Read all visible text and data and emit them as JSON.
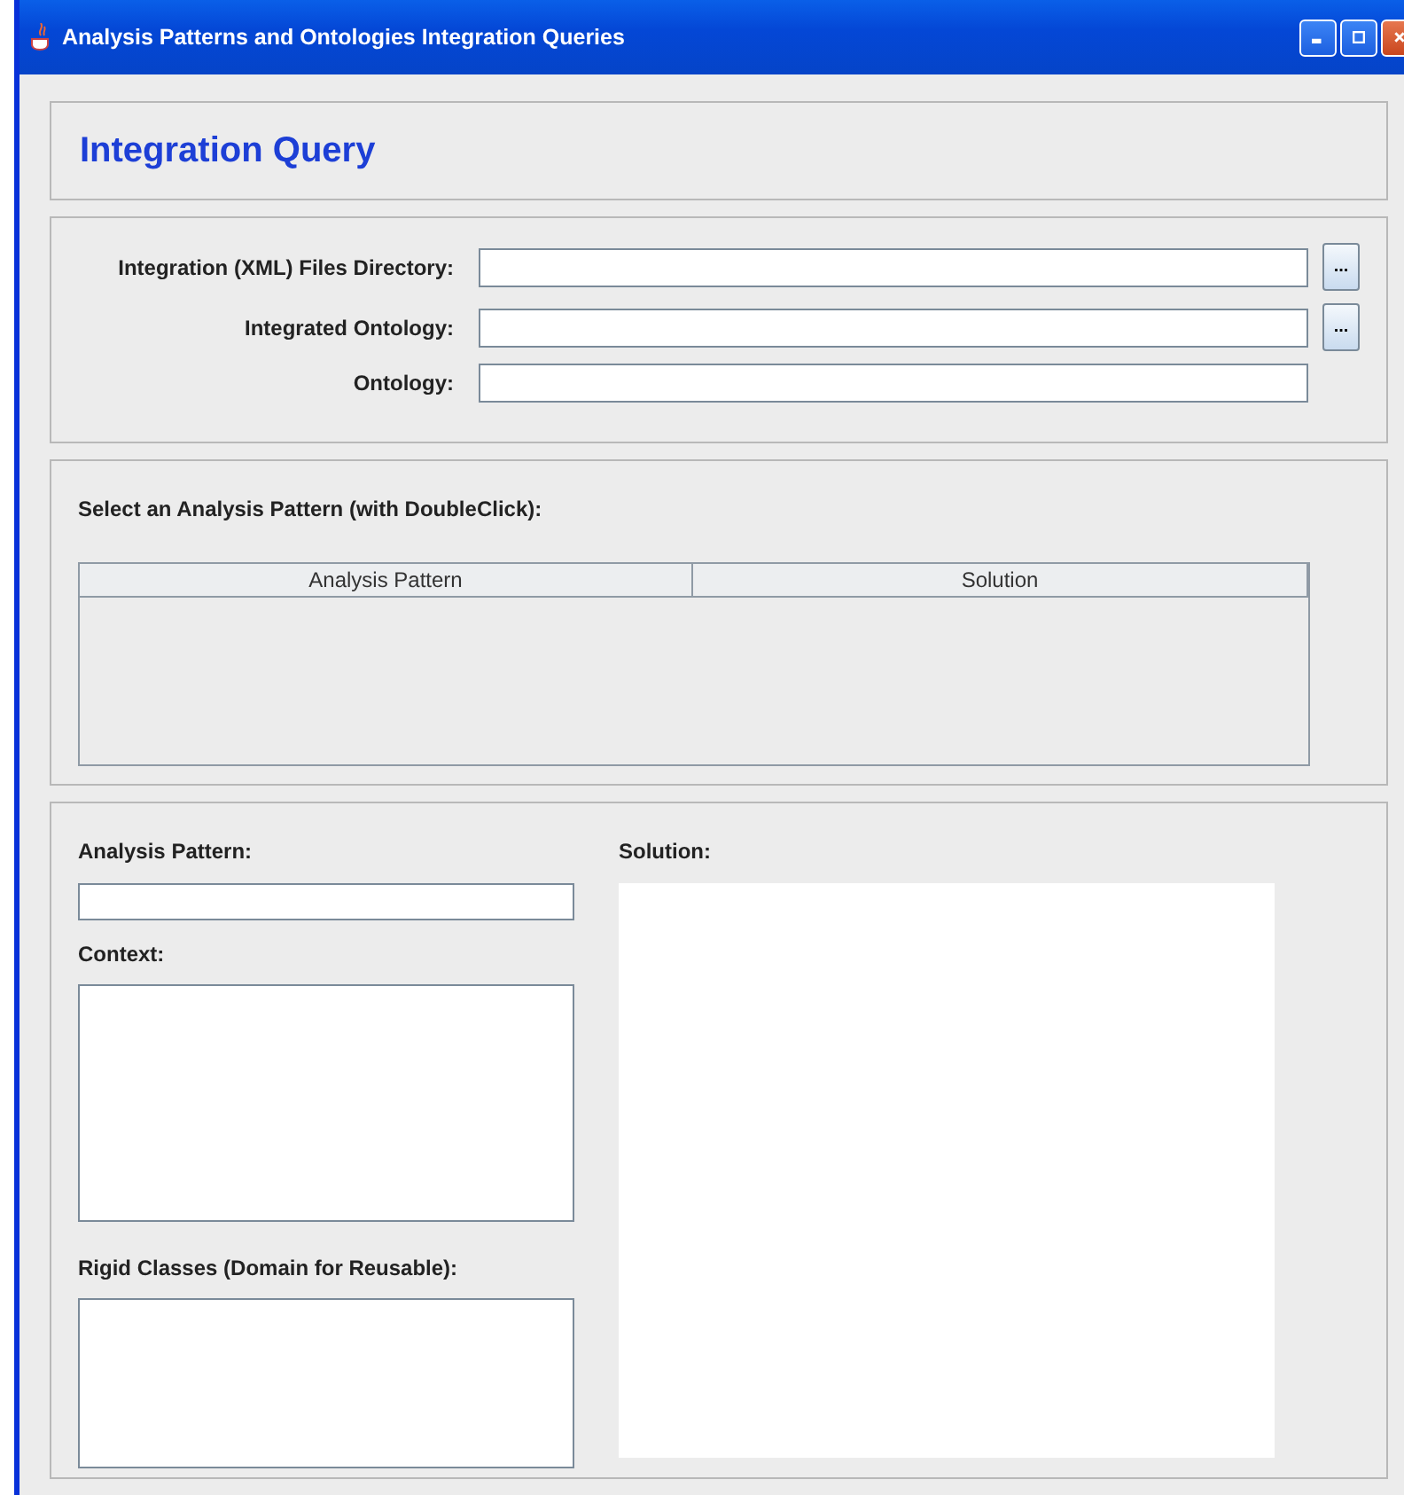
{
  "window": {
    "title": "Analysis Patterns and Ontologies Integration Queries"
  },
  "header": {
    "title": "Integration Query"
  },
  "paths": [
    {
      "label": "Integration (XML) Files Directory:",
      "browse": "..."
    },
    {
      "label": "Integrated Ontology:",
      "browse": "..."
    },
    {
      "label": "Ontology:"
    }
  ],
  "pattern_table": {
    "caption": "Select an Analysis Pattern (with DoubleClick):",
    "columns": [
      "Analysis Pattern",
      "Solution"
    ]
  },
  "details": {
    "analysis_pattern_label": "Analysis Pattern:",
    "context_label": "Context:",
    "rigid_classes_label": "Rigid Classes (Domain for Reusable):",
    "solution_label": "Solution:"
  }
}
